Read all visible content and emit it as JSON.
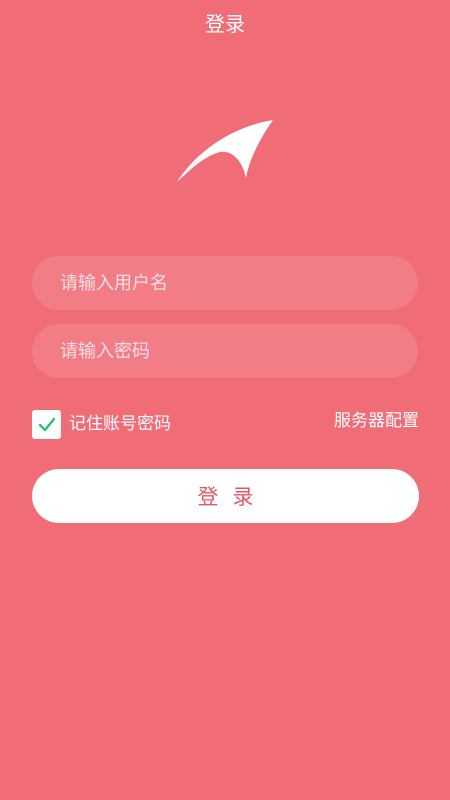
{
  "header": {
    "title": "登录"
  },
  "logo": {
    "icon": "swoosh-logo-icon",
    "color": "#ffffff"
  },
  "form": {
    "username": {
      "placeholder": "请输入用户名",
      "value": ""
    },
    "password": {
      "placeholder": "请输入密码",
      "value": ""
    },
    "remember": {
      "label": "记住账号密码",
      "checked": true,
      "check_color": "#2bbf72"
    },
    "server_config_label": "服务器配置",
    "login_button_label": "登录"
  },
  "colors": {
    "background": "#f06c77",
    "field_background": "#f27d87",
    "button_text": "#e35864"
  }
}
